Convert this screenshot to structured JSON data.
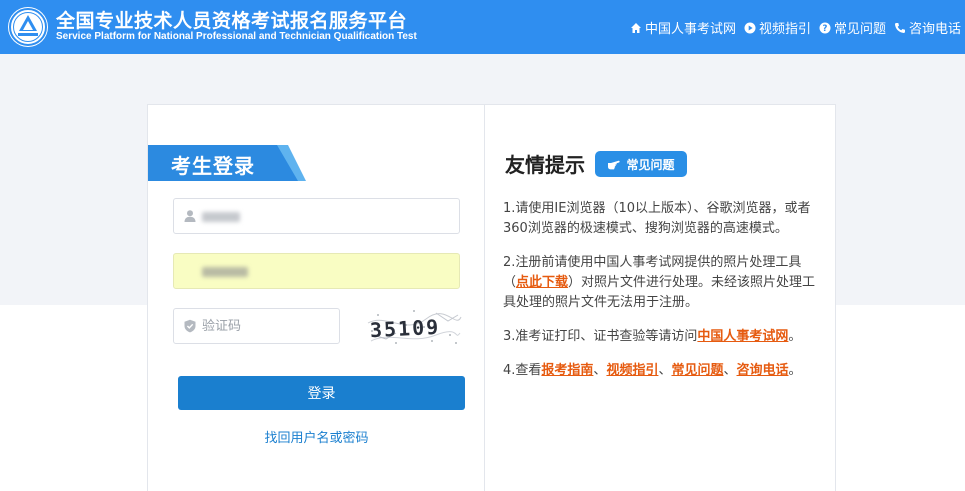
{
  "header": {
    "title_cn": "全国专业技术人员资格考试报名服务平台",
    "title_en": "Service Platform for National Professional and Technician Qualification Test",
    "nav": [
      {
        "label": "中国人事考试网",
        "icon": "home-icon"
      },
      {
        "label": "视频指引",
        "icon": "play-icon"
      },
      {
        "label": "常见问题",
        "icon": "question-icon"
      },
      {
        "label": "咨询电话",
        "icon": "phone-icon"
      }
    ]
  },
  "login": {
    "title": "考生登录",
    "username_placeholder": "",
    "password_placeholder": "",
    "captcha_placeholder": "验证码",
    "captcha_text": "35109",
    "submit_label": "登录",
    "forgot_label": "找回用户名或密码"
  },
  "tips": {
    "title": "友情提示",
    "faq_badge": "常见问题",
    "t1": "1.请使用IE浏览器（10以上版本）、谷歌浏览器，或者360浏览器的极速模式、搜狗浏览器的高速模式。",
    "t2_a": "2.注册前请使用中国人事考试网提供的照片处理工具（",
    "t2_link": "点此下载",
    "t2_b": "）对照片文件进行处理。未经该照片处理工具处理的照片文件无法用于注册。",
    "t3_a": "3.准考证打印、证书查验等请访问",
    "t3_link": "中国人事考试网",
    "t3_b": "。",
    "t4_a": "4.查看",
    "t4_link1": "报考指南",
    "t4_sep1": "、",
    "t4_link2": "视频指引",
    "t4_sep2": "、",
    "t4_link3": "常见问题",
    "t4_sep3": "、",
    "t4_link4": "咨询电话",
    "t4_b": "。"
  },
  "colors": {
    "header_bg": "#2f8ef0",
    "primary_button": "#1a7fcf",
    "link_orange": "#e65b10",
    "password_field_bg": "#f9fdc3"
  }
}
